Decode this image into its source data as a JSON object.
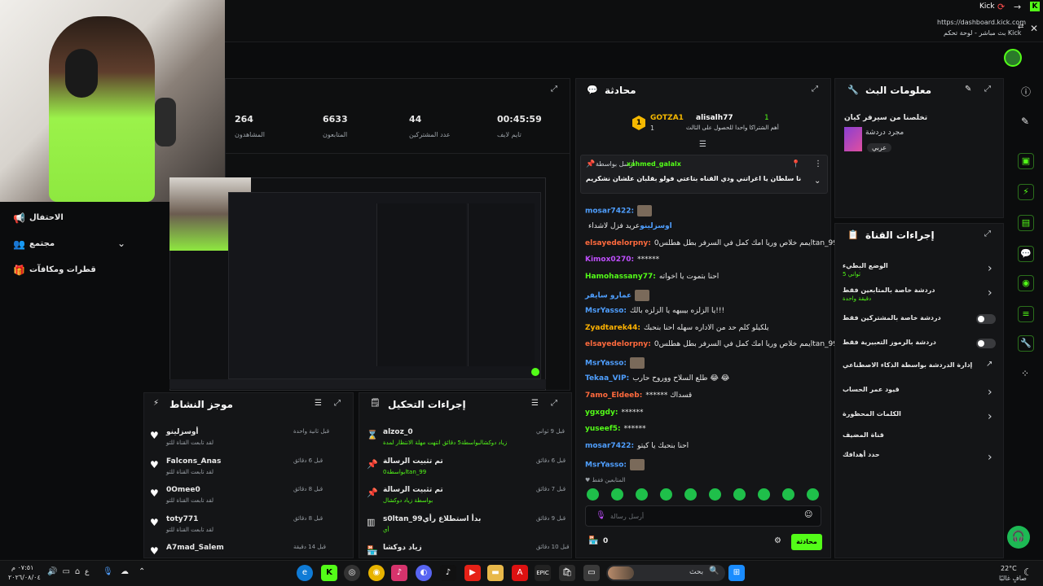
{
  "app": {
    "title": "Kick",
    "url": "https://dashboard.kick.com",
    "window_title": "بث مباشر - لوحة تحكم Kick"
  },
  "sidebar": {
    "items": [
      {
        "label": "الاحتفال",
        "icon": "megaphone-icon"
      },
      {
        "label": "مجتمع",
        "icon": "people-icon"
      },
      {
        "label": "قطرات ومكافآت",
        "icon": "gift-icon"
      }
    ]
  },
  "stats": [
    {
      "value": "264",
      "label": "المشاهدون"
    },
    {
      "value": "6633",
      "label": "المتابعون"
    },
    {
      "value": "44",
      "label": "عدد المشتركين"
    },
    {
      "value": "00:45:59",
      "label": "تايم لايف"
    }
  ],
  "chat": {
    "title": "محادثة",
    "leaderboard": {
      "first_user": "GOTZA1",
      "first_count": "1",
      "second_user": "alisalh77",
      "second_count": "1",
      "hint": "أهم الشتراكا واحدا للحصول على الثالث"
    },
    "pinned": {
      "sender_prefix": "أرسل بواسطة",
      "sender": "xahmed_galalx",
      "message": "نا سلطان يا اغراتني ودي القناه بتاعتي فولو بقلبان علشان نشكريم"
    },
    "messages": [
      {
        "user": "mosar7422:",
        "text": "",
        "color": "#4f9fff",
        "emote": true
      },
      {
        "user": "اوسزلينو",
        "text": "عريد فزل لاشداء",
        "color": "#4f9fff",
        "emote": false
      },
      {
        "user": "elsayedelorpny:",
        "text": "يمم خلاص وريا امك كمل في السرفر بطل هطلس0ltan_99",
        "color": "#ff6a3d",
        "emote": false
      },
      {
        "user": "Kimox0270:",
        "text": "******",
        "color": "#c04fff",
        "emote": false
      },
      {
        "user": "Hamohassany77:",
        "text": "احنا بتموت يا اخواته",
        "color": "#53fc18",
        "emote": false
      },
      {
        "user": "عمارو سايفر",
        "text": "",
        "color": "#4f9fff",
        "emote": true
      },
      {
        "user": "MsrYasso:",
        "text": "يا الزلزه بيبيهه يا الزلزه بالك!!!",
        "color": "#4f9fff",
        "emote": false
      },
      {
        "user": "Zyadtarek44:",
        "text": "يلكيلو كلم حد من الاداره سهله احنا بنحبك",
        "color": "#ffb300",
        "emote": false
      },
      {
        "user": "elsayedelorpny:",
        "text": "يمم خلاص وريا امك كمل في السرفر بطل هطلس0ltan_99",
        "color": "#ff6a3d",
        "emote": false
      },
      {
        "user": "MsrYasso:",
        "text": "",
        "color": "#4f9fff",
        "emote": true
      },
      {
        "user": "Tekaa_VIP:",
        "text": "طلع السلاح ووروح حارب 😂 😂",
        "color": "#4f9fff",
        "emote": false
      },
      {
        "user": "7amo_Eldeeb:",
        "text": "****** قسداك",
        "color": "#ff6a3d",
        "emote": false
      },
      {
        "user": "ygxgdy:",
        "text": "******",
        "color": "#53fc18",
        "emote": false
      },
      {
        "user": "yuseef5:",
        "text": "******",
        "color": "#53fc18",
        "emote": false
      },
      {
        "user": "mosar7422:",
        "text": "احنا بنحبك يا كيتو",
        "color": "#4f9fff",
        "emote": false
      },
      {
        "user": "MsrYasso:",
        "text": "",
        "color": "#4f9fff",
        "emote": true
      }
    ],
    "followers_only": "المتابعين فقط",
    "input_placeholder": "أرسل رسالة",
    "count": "0",
    "send_label": "محادثة"
  },
  "stream_info": {
    "title": "معلومات البث",
    "stream_title": "تخلصنا من سيرفر كيان",
    "category": "مجرد دردشة",
    "language": "عربي"
  },
  "channel_actions": {
    "title": "إجراءات القناة",
    "items": [
      {
        "label": "الوضع البطيء",
        "sub": "5 ثواني",
        "control": "chevron"
      },
      {
        "label": "دردشة خاصة بالمتابعين فقط",
        "sub": "دقيقة واحدة",
        "control": "chevron"
      },
      {
        "label": "دردشة خاصة بالمشتركين فقط",
        "sub": "",
        "control": "toggle"
      },
      {
        "label": "دردشة بالرموز التعبيرية فقط",
        "sub": "",
        "control": "toggle"
      },
      {
        "label": "إدارة الدردشة بواسطة الذكاء الاصطناعي",
        "sub": "",
        "control": "external"
      },
      {
        "label": "قيود عمر الحساب",
        "sub": "",
        "control": "chevron"
      },
      {
        "label": "الكلمات المحظورة",
        "sub": "",
        "control": "chevron"
      },
      {
        "label": "قناة المضيف",
        "sub": "",
        "control": "none"
      },
      {
        "label": "حدد أهدافك",
        "sub": "",
        "control": "chevron"
      }
    ]
  },
  "activity": {
    "title": "موجز النشاط",
    "items": [
      {
        "user": "أوسزلينو",
        "action": "لقد تابعت القناة للتو",
        "time": "قبل ثانية واحدة"
      },
      {
        "user": "Falcons_Anas",
        "action": "لقد تابعت القناة للتو",
        "time": "قبل 6 دقائق"
      },
      {
        "user": "0Omee0",
        "action": "لقد تابعت القناة للتو",
        "time": "قبل 8 دقائق"
      },
      {
        "user": "toty771",
        "action": "لقد تابعت القناة للتو",
        "time": "قبل 8 دقائق"
      },
      {
        "user": "A7mad_Salem",
        "action": "",
        "time": "قبل 14 دقيقة"
      }
    ]
  },
  "moderation": {
    "title": "إجراءات التحكيل",
    "items": [
      {
        "icon": "hourglass-icon",
        "title": "alzoz_0",
        "detail": "زياد دوكشالبواسطة5 دقائق انتهت مهلة الانتظار لمدة",
        "time": "قبل 9 ثواني"
      },
      {
        "icon": "pin-icon",
        "title": "تم تثبيت الرسالة",
        "detail": "بواسطة0ltan_99",
        "time": "قبل 6 دقائق"
      },
      {
        "icon": "pin-icon",
        "title": "تم تثبيت الرسالة",
        "detail": "بواسطة زياد دوكشال",
        "time": "قبل 7 دقائق"
      },
      {
        "icon": "poll-icon",
        "title": "s0ltan_99بدأ استطلاع رأي",
        "detail": "أي",
        "time": "قبل 9 دقائق"
      },
      {
        "icon": "store-icon",
        "title": "زياد دوكشا",
        "detail": "",
        "time": "قبل 10 دقائق"
      }
    ]
  },
  "taskbar": {
    "time": "٠٧:٥١ م",
    "date": "٢٠٢٦/٠٨/٠٤",
    "search_placeholder": "بحث",
    "weather_temp": "22°C",
    "weather_desc": "صافٍ غالبًا",
    "lang": "ع"
  }
}
